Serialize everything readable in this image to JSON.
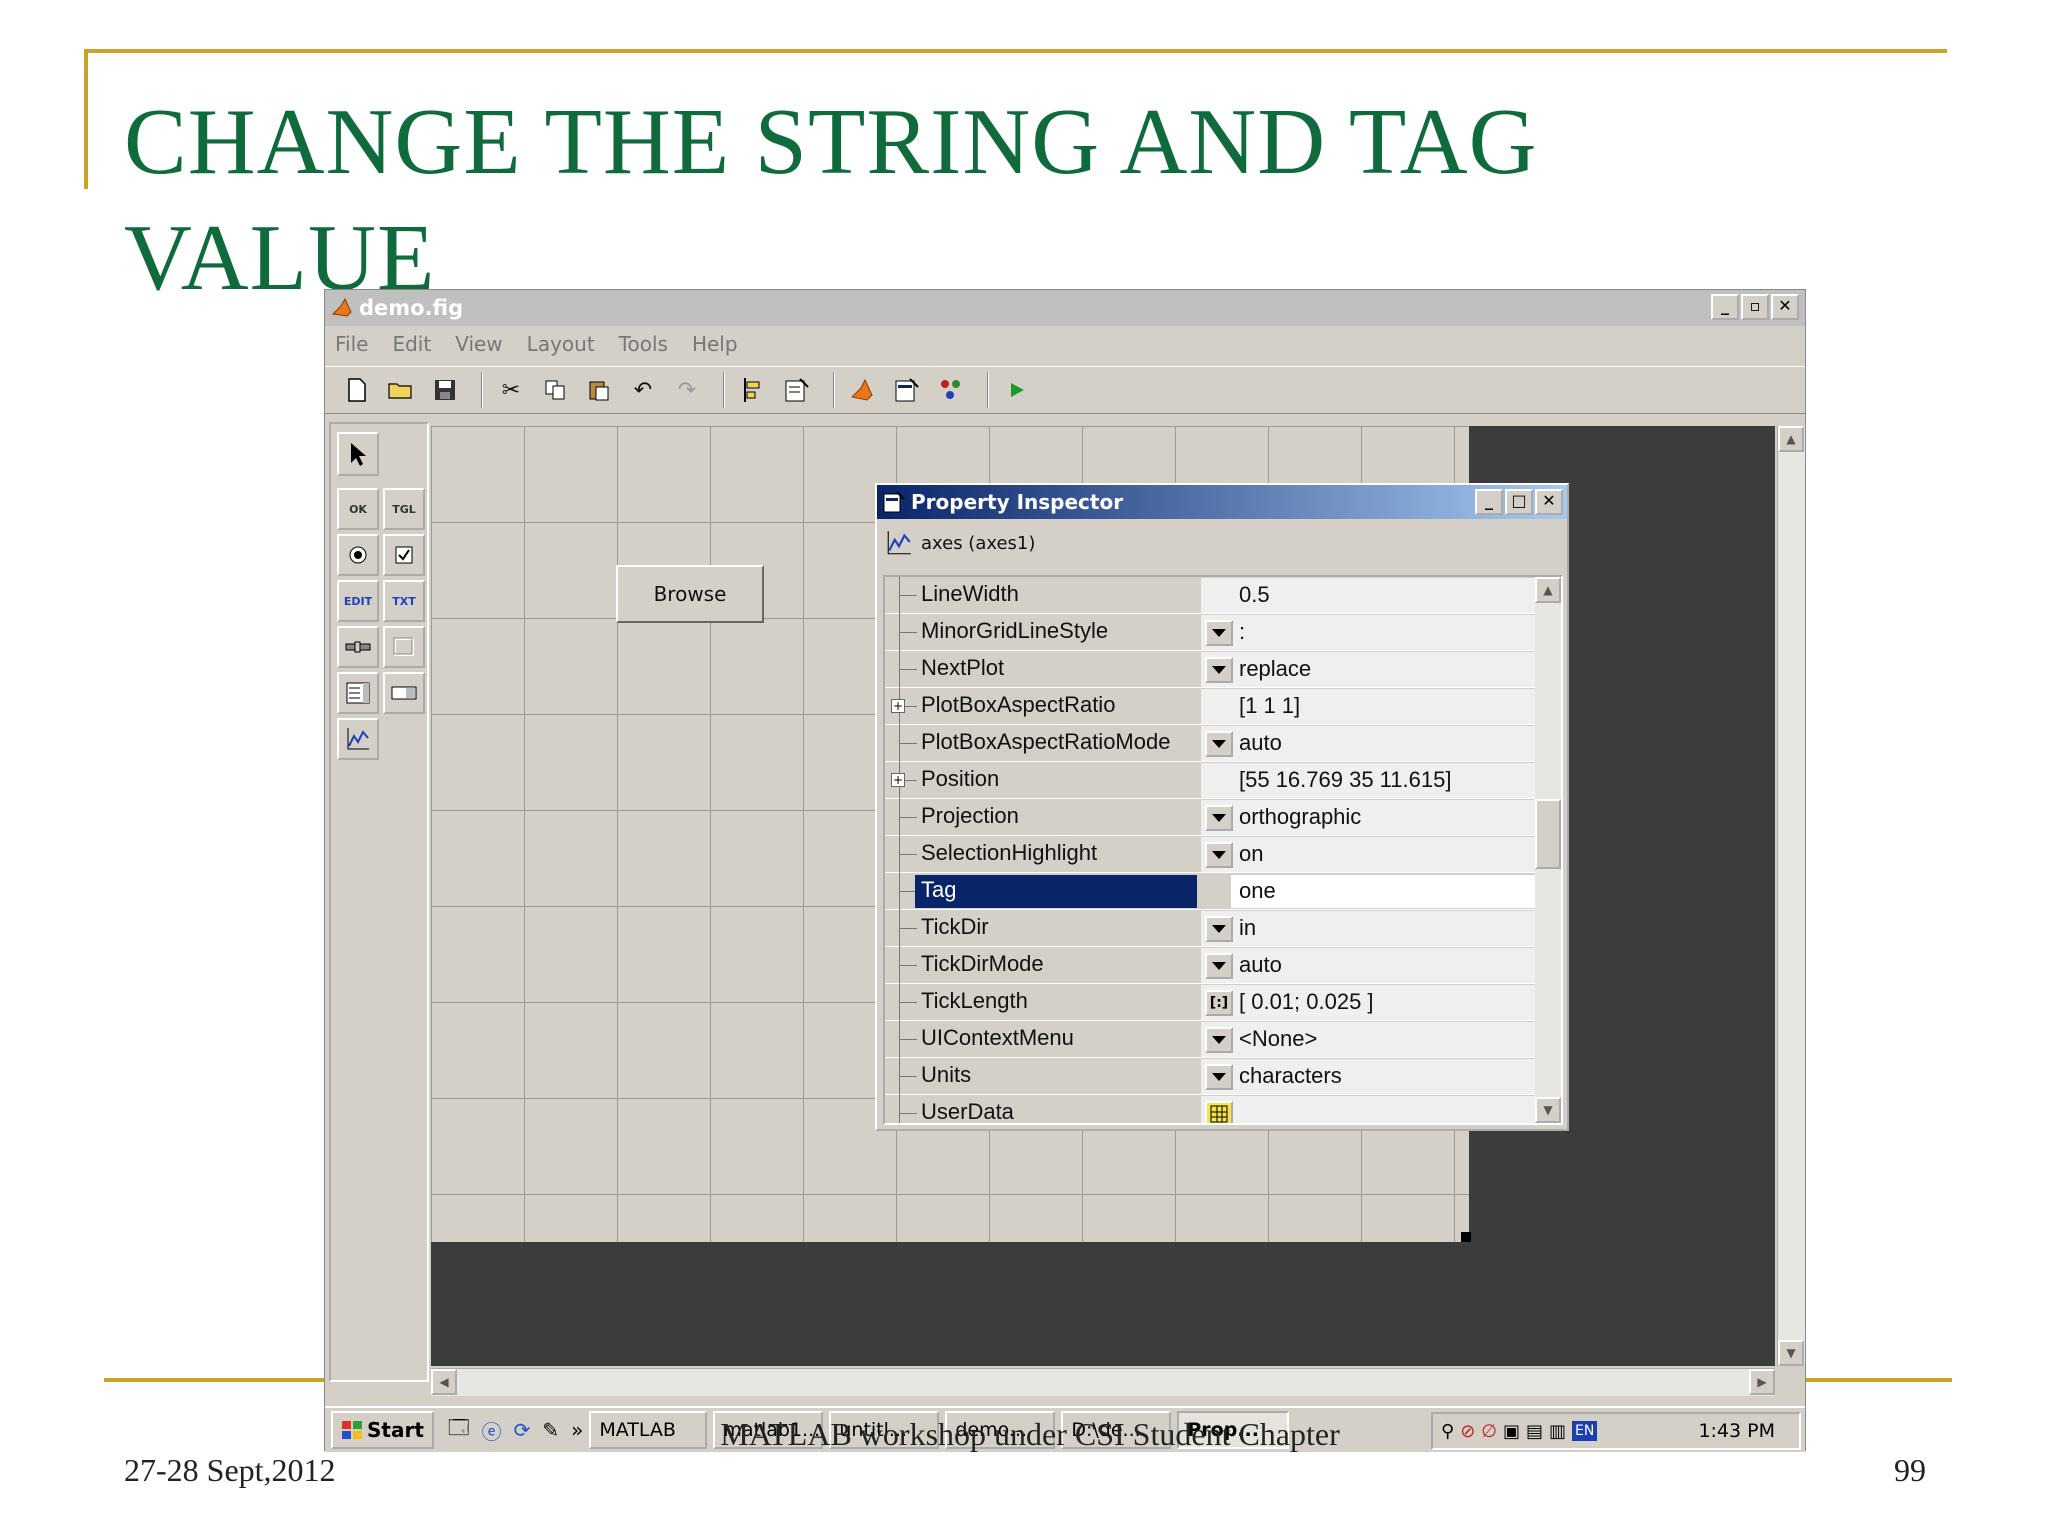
{
  "slide": {
    "title": "CHANGE THE STRING AND TAG VALUE",
    "footer_date": "27-28 Sept,2012",
    "footer_center": "MATLAB workshop under CSI Student Chapter",
    "page_number": "99"
  },
  "window": {
    "title": "demo.fig",
    "controls": [
      "_",
      "▫",
      "✕"
    ]
  },
  "menu": [
    "File",
    "Edit",
    "View",
    "Layout",
    "Tools",
    "Help"
  ],
  "toolbar": {
    "icons": [
      "new-file-icon",
      "open-folder-icon",
      "save-icon",
      "cut-icon",
      "copy-icon",
      "paste-icon",
      "undo-icon",
      "redo-icon",
      "align-icon",
      "menu-editor-icon",
      "matlab-icon",
      "property-inspector-icon",
      "object-browser-icon",
      "run-icon"
    ]
  },
  "palette": {
    "tools": [
      "select",
      "OK",
      "TGL",
      "radio",
      "check",
      "EDIT",
      "TXT",
      "slider",
      "frame",
      "listbox",
      "popup",
      "axes"
    ]
  },
  "canvas": {
    "browse_label": "Browse"
  },
  "inspector": {
    "title": "Property Inspector",
    "object": "axes (axes1)",
    "rows": [
      {
        "name": "LineWidth",
        "value": "0.5",
        "control": "none",
        "expandable": false
      },
      {
        "name": "MinorGridLineStyle",
        "value": ":",
        "control": "dropdown",
        "expandable": false
      },
      {
        "name": "NextPlot",
        "value": "replace",
        "control": "dropdown",
        "expandable": false
      },
      {
        "name": "PlotBoxAspectRatio",
        "value": "[1 1 1]",
        "control": "none",
        "expandable": true
      },
      {
        "name": "PlotBoxAspectRatioMode",
        "value": "auto",
        "control": "dropdown",
        "expandable": false
      },
      {
        "name": "Position",
        "value": "[55 16.769 35 11.615]",
        "control": "none",
        "expandable": true
      },
      {
        "name": "Projection",
        "value": "orthographic",
        "control": "dropdown",
        "expandable": false
      },
      {
        "name": "SelectionHighlight",
        "value": "on",
        "control": "dropdown",
        "expandable": false
      },
      {
        "name": "Tag",
        "value": "one",
        "control": "none",
        "expandable": false,
        "selected": true
      },
      {
        "name": "TickDir",
        "value": "in",
        "control": "dropdown",
        "expandable": false
      },
      {
        "name": "TickDirMode",
        "value": "auto",
        "control": "dropdown",
        "expandable": false
      },
      {
        "name": "TickLength",
        "value": "[ 0.01; 0.025 ]",
        "control": "array",
        "expandable": false
      },
      {
        "name": "UIContextMenu",
        "value": "<None>",
        "control": "dropdown",
        "expandable": false
      },
      {
        "name": "Units",
        "value": "characters",
        "control": "dropdown",
        "expandable": false
      },
      {
        "name": "UserData",
        "value": "",
        "control": "grid",
        "expandable": false
      }
    ]
  },
  "taskbar": {
    "start_label": "Start",
    "items": [
      "MATLAB",
      "matlab1...",
      "untitl...",
      "demo...",
      "D:\\de...",
      "Prop..."
    ],
    "active_item": "Prop...",
    "time": "1:43 PM",
    "lang": "EN"
  },
  "colors": {
    "title_green": "#0f6a3c",
    "gold_rule": "#c9a227",
    "selection_blue": "#0a246a"
  }
}
